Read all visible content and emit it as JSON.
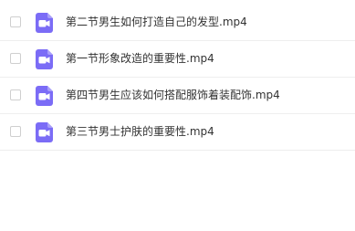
{
  "files": [
    {
      "name": "第二节男生如何打造自己的发型.mp4",
      "icon": "video-file-icon"
    },
    {
      "name": "第一节形象改造的重要性.mp4",
      "icon": "video-file-icon"
    },
    {
      "name": "第四节男生应该如何搭配服饰着装配饰.mp4",
      "icon": "video-file-icon"
    },
    {
      "name": "第三节男士护肤的重要性.mp4",
      "icon": "video-file-icon"
    }
  ],
  "colors": {
    "icon_bg": "#7B6CF6",
    "icon_fg": "#ffffff",
    "text": "#333333",
    "divider": "#eeeeee",
    "checkbox_border": "#cfcfcf"
  }
}
